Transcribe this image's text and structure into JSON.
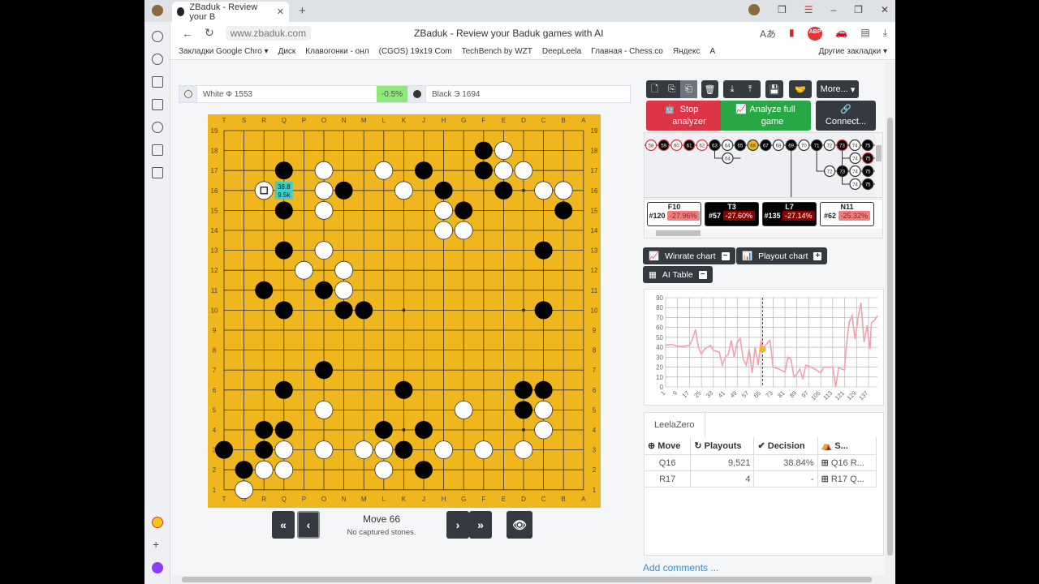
{
  "browser": {
    "tab_title": "ZBaduk - Review your B",
    "url": "www.zbaduk.com",
    "page_title": "ZBaduk - Review your Baduk games with AI",
    "bookmarks": [
      "Закладки Google Chro ▾",
      "Диск",
      "Клавогонки - онл",
      "(CGOS) 19x19 Com",
      "TechBench by WZT",
      "DeepLeela",
      "Главная - Chess.co",
      "Яндекс",
      "A"
    ],
    "other_bookmarks": "Другие закладки ▾"
  },
  "players": {
    "white": "White Ф 1553",
    "white_score": "-0.5%",
    "black": "Black Э 1694"
  },
  "board": {
    "columns": [
      "T",
      "S",
      "R",
      "Q",
      "P",
      "O",
      "N",
      "M",
      "L",
      "K",
      "J",
      "H",
      "G",
      "F",
      "E",
      "D",
      "C",
      "B",
      "A"
    ],
    "black": [
      "F18",
      "Q17",
      "J17",
      "F17",
      "N16",
      "H16",
      "E16",
      "Q15",
      "G15",
      "B15",
      "Q13",
      "C13",
      "R11",
      "O11",
      "Q10",
      "N10",
      "M10",
      "C10",
      "O7",
      "Q6",
      "K6",
      "D6",
      "C6",
      "D5",
      "R4",
      "Q4",
      "L4",
      "J4",
      "T3",
      "R3",
      "K3",
      "S2",
      "J2"
    ],
    "white": [
      "E18",
      "O17",
      "L17",
      "E17",
      "D17",
      "R16",
      "O16",
      "K16",
      "C16",
      "B16",
      "O15",
      "H15",
      "H14",
      "G14",
      "O13",
      "P12",
      "N12",
      "N11",
      "O5",
      "G5",
      "C5",
      "C4",
      "Q3",
      "O3",
      "M3",
      "L3",
      "H3",
      "F3",
      "D3",
      "R2",
      "Q2",
      "L2",
      "S1"
    ],
    "last_move": "R16",
    "suggestion": {
      "point": "Q16",
      "winrate": "38.8",
      "playouts": "9.5k"
    },
    "star_points": [
      "D4",
      "K4",
      "Q4",
      "D10",
      "K10",
      "Q10",
      "D16",
      "K16",
      "Q16"
    ]
  },
  "nav": {
    "move": "Move 66",
    "captures": "No captured stones."
  },
  "toolbar": {
    "more": "More...",
    "stop": "Stop analyzer",
    "analyze": "Analyze full game",
    "connect": "Connect..."
  },
  "tree": {
    "main": [
      {
        "n": 58,
        "c": "w",
        "bad": true
      },
      {
        "n": 59,
        "c": "b",
        "bad": true
      },
      {
        "n": 60,
        "c": "w",
        "bad": true
      },
      {
        "n": 61,
        "c": "b",
        "bad": true
      },
      {
        "n": 62,
        "c": "w",
        "bad": true
      },
      {
        "n": 63,
        "c": "b"
      },
      {
        "n": 64,
        "c": "w"
      },
      {
        "n": 65,
        "c": "b"
      },
      {
        "n": 66,
        "c": "cur"
      },
      {
        "n": 67,
        "c": "b"
      },
      {
        "n": 68,
        "c": "w"
      },
      {
        "n": 69,
        "c": "b"
      },
      {
        "n": 70,
        "c": "w"
      },
      {
        "n": 71,
        "c": "b"
      },
      {
        "n": 72,
        "c": "w"
      },
      {
        "n": 73,
        "c": "b",
        "bad": true
      },
      {
        "n": 74,
        "c": "w"
      },
      {
        "n": 75,
        "c": "b"
      }
    ],
    "variations": [
      {
        "from": 63,
        "depth": 1,
        "moves": [
          {
            "n": 64,
            "c": "w"
          }
        ]
      },
      {
        "from": 73,
        "depth": 1,
        "moves": [
          {
            "n": 74,
            "c": "w"
          },
          {
            "n": 75,
            "c": "b",
            "bad": true
          }
        ]
      },
      {
        "from": 71,
        "depth": 2,
        "moves": [
          {
            "n": 72,
            "c": "w"
          },
          {
            "n": 73,
            "c": "b"
          },
          {
            "n": 74,
            "c": "w"
          },
          {
            "n": 75,
            "c": "b"
          }
        ]
      },
      {
        "from": 73,
        "depth": 3,
        "moves": [
          {
            "n": 74,
            "c": "w"
          },
          {
            "n": 75,
            "c": "b"
          }
        ]
      }
    ]
  },
  "mistakes": [
    {
      "move": "F10",
      "num": "#120",
      "loss": "-27.96%",
      "color": "w"
    },
    {
      "move": "T3",
      "num": "#57",
      "loss": "-27.60%",
      "color": "b"
    },
    {
      "move": "L7",
      "num": "#135",
      "loss": "-27.14%",
      "color": "b"
    },
    {
      "move": "N11",
      "num": "#62",
      "loss": "-25.32%",
      "color": "w"
    }
  ],
  "panels": {
    "winrate": "Winrate chart",
    "playout": "Playout chart",
    "aitable": "AI Table"
  },
  "chart_data": {
    "type": "line",
    "ylim": [
      0,
      90
    ],
    "yticks": [
      "0",
      "10",
      "20",
      "30",
      "40",
      "50",
      "60",
      "70",
      "80",
      "90"
    ],
    "xticks": [
      "1",
      "9",
      "17",
      "25",
      "33",
      "41",
      "49",
      "57",
      "65",
      "73",
      "81",
      "89",
      "97",
      "105",
      "113",
      "121",
      "129",
      "137"
    ],
    "xlim": [
      1,
      143
    ],
    "current_move": 66,
    "current_value": 38,
    "series_color": "#f4a0ae",
    "x": [
      1,
      5,
      9,
      13,
      17,
      19,
      21,
      23,
      25,
      27,
      29,
      31,
      33,
      35,
      37,
      39,
      41,
      43,
      45,
      47,
      49,
      51,
      53,
      55,
      57,
      59,
      61,
      63,
      65,
      66,
      69,
      71,
      73,
      77,
      81,
      83,
      85,
      87,
      89,
      91,
      93,
      95,
      97,
      101,
      105,
      107,
      113,
      115,
      117,
      119,
      121,
      122,
      124,
      126,
      128,
      130,
      132,
      134,
      136,
      138,
      139,
      141,
      143
    ],
    "values": [
      42,
      43,
      41,
      41,
      42,
      48,
      58,
      40,
      33,
      38,
      40,
      42,
      37,
      36,
      35,
      22,
      30,
      33,
      47,
      30,
      45,
      49,
      28,
      22,
      38,
      14,
      40,
      22,
      47,
      38,
      44,
      47,
      20,
      18,
      15,
      30,
      28,
      10,
      13,
      18,
      8,
      22,
      21,
      18,
      14,
      20,
      20,
      0,
      20,
      18,
      17,
      40,
      65,
      72,
      48,
      70,
      85,
      45,
      62,
      38,
      65,
      67,
      72
    ]
  },
  "ai": {
    "engine": "LeelaZero",
    "headers": [
      "Move",
      "Playouts",
      "Decision",
      "S..."
    ],
    "rows": [
      {
        "move": "Q16",
        "playouts": "9,521",
        "decision": "38.84%",
        "seq": "Q16 R..."
      },
      {
        "move": "R17",
        "playouts": "4",
        "decision": "-",
        "seq": "R17 Q..."
      }
    ]
  },
  "comments": "Add comments ..."
}
